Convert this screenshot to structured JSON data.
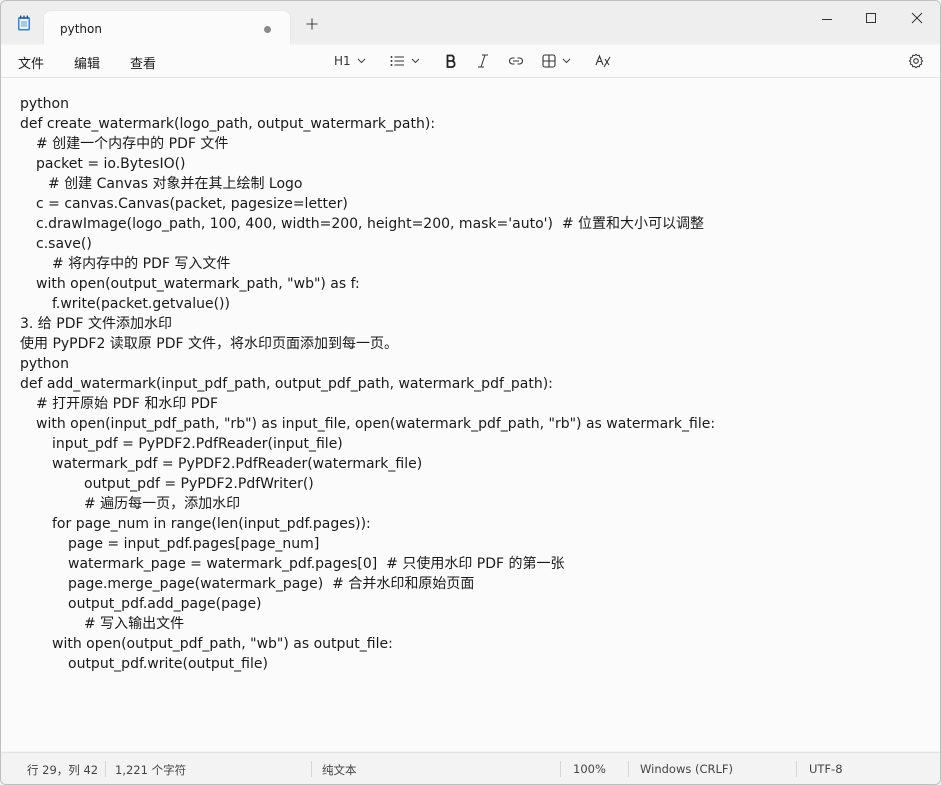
{
  "tab": {
    "title": "python"
  },
  "menu": {
    "file": "文件",
    "edit": "编辑",
    "view": "查看"
  },
  "toolbar": {
    "heading": "H1"
  },
  "editor": {
    "lines": [
      {
        "indent": 0,
        "text": "python"
      },
      {
        "indent": 0,
        "text": "def create_watermark(logo_path, output_watermark_path):"
      },
      {
        "indent": 16,
        "text": "# 创建一个内存中的 PDF 文件"
      },
      {
        "indent": 16,
        "text": "packet = io.BytesIO()"
      },
      {
        "indent": 28,
        "text": "# 创建 Canvas 对象并在其上绘制 Logo"
      },
      {
        "indent": 16,
        "text": "c = canvas.Canvas(packet, pagesize=letter)"
      },
      {
        "indent": 16,
        "text": "c.drawImage(logo_path, 100, 400, width=200, height=200, mask='auto')  # 位置和大小可以调整"
      },
      {
        "indent": 16,
        "text": "c.save()"
      },
      {
        "indent": 32,
        "text": "# 将内存中的 PDF 写入文件"
      },
      {
        "indent": 16,
        "text": "with open(output_watermark_path, \"wb\") as f:"
      },
      {
        "indent": 32,
        "text": "f.write(packet.getvalue())"
      },
      {
        "indent": 0,
        "text": "3. 给 PDF 文件添加水印"
      },
      {
        "indent": 0,
        "text": "使用 PyPDF2 读取原 PDF 文件，将水印页面添加到每一页。"
      },
      {
        "indent": 0,
        "text": "python"
      },
      {
        "indent": 0,
        "text": "def add_watermark(input_pdf_path, output_pdf_path, watermark_pdf_path):"
      },
      {
        "indent": 16,
        "text": "# 打开原始 PDF 和水印 PDF"
      },
      {
        "indent": 16,
        "text": "with open(input_pdf_path, \"rb\") as input_file, open(watermark_pdf_path, \"rb\") as watermark_file:"
      },
      {
        "indent": 32,
        "text": "input_pdf = PyPDF2.PdfReader(input_file)"
      },
      {
        "indent": 32,
        "text": "watermark_pdf = PyPDF2.PdfReader(watermark_file)"
      },
      {
        "indent": 64,
        "text": "output_pdf = PyPDF2.PdfWriter()"
      },
      {
        "indent": 64,
        "text": "# 遍历每一页，添加水印"
      },
      {
        "indent": 32,
        "text": "for page_num in range(len(input_pdf.pages)):"
      },
      {
        "indent": 48,
        "text": "page = input_pdf.pages[page_num]"
      },
      {
        "indent": 48,
        "text": "watermark_page = watermark_pdf.pages[0]  # 只使用水印 PDF 的第一张"
      },
      {
        "indent": 48,
        "text": "page.merge_page(watermark_page)  # 合并水印和原始页面"
      },
      {
        "indent": 48,
        "text": "output_pdf.add_page(page)"
      },
      {
        "indent": 64,
        "text": "# 写入输出文件"
      },
      {
        "indent": 32,
        "text": "with open(output_pdf_path, \"wb\") as output_file:"
      },
      {
        "indent": 48,
        "text": "output_pdf.write(output_file)"
      }
    ]
  },
  "status": {
    "position": "行 29，列 42",
    "chars": "1,221 个字符",
    "format": "纯文本",
    "zoom": "100%",
    "line_ending": "Windows (CRLF)",
    "encoding": "UTF-8"
  }
}
